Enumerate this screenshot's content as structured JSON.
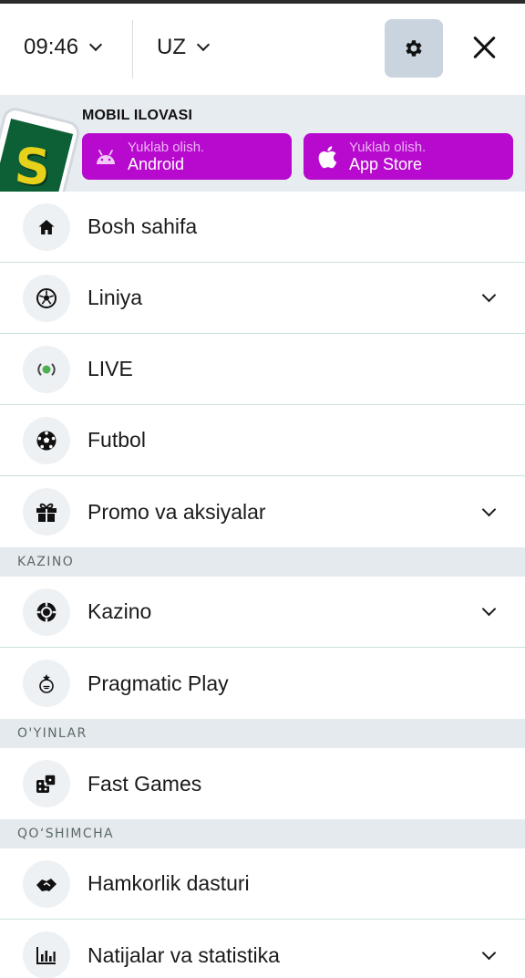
{
  "header": {
    "time": "09:46",
    "language": "UZ",
    "settings_icon": "gear-icon",
    "close_icon": "close-icon"
  },
  "app_banner": {
    "title": "MOBIL ILOVASI",
    "logo_letter": "S",
    "android": {
      "small": "Yuklab olish.",
      "big": "Android",
      "icon": "android-icon"
    },
    "apple": {
      "small": "Yuklab olish.",
      "big": "App Store",
      "icon": "apple-icon"
    }
  },
  "menu": {
    "items": [
      {
        "label": "Bosh sahifa",
        "icon": "home-icon"
      },
      {
        "label": "Liniya",
        "icon": "soccer-ball-icon",
        "expandable": true
      },
      {
        "label": "LIVE",
        "icon": "live-broadcast-icon"
      },
      {
        "label": "Futbol",
        "icon": "football-icon"
      },
      {
        "label": "Promo va aksiyalar",
        "icon": "gift-icon",
        "expandable": true
      }
    ],
    "sections": [
      {
        "title": "KAZINO",
        "items": [
          {
            "label": "Kazino",
            "icon": "casino-chip-icon",
            "expandable": true
          },
          {
            "label": "Pragmatic Play",
            "icon": "pragmatic-play-icon"
          }
        ]
      },
      {
        "title": "O'YINLAR",
        "items": [
          {
            "label": "Fast Games",
            "icon": "dice-icon"
          }
        ]
      },
      {
        "title": "QO‘SHIMCHA",
        "items": [
          {
            "label": "Hamkorlik dasturi",
            "icon": "handshake-icon"
          },
          {
            "label": "Natijalar va statistika",
            "icon": "statistics-icon",
            "expandable": true
          }
        ]
      }
    ]
  },
  "colors": {
    "accent_purple": "#b80acf",
    "banner_bg": "#e7ecf1",
    "section_bg": "#e5eaee",
    "divider": "#c9e3d4",
    "live_green": "#4caf50"
  }
}
